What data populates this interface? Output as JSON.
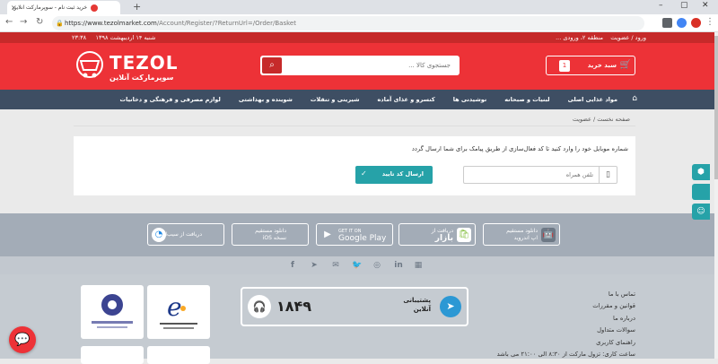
{
  "browser": {
    "tab_title": "خرید ثبت نام - سوپرمارکت آنلاین",
    "url_host": "https://www.tezolmarket.com",
    "url_path": "/Account/Register/?ReturnUrl=/Order/Basket",
    "new_tab_icon": "plus-icon"
  },
  "topstrip": {
    "date": "شنبه ۱۴ اردیبهشت ۱۳۹۸",
    "time": "۲۳:۳۸",
    "login": "ورود / عضویت",
    "region": "منطقه ۲، ورودی ..."
  },
  "header": {
    "brand": "TEZOL",
    "subtitle": "سوپرمارکت آنلاین",
    "search_placeholder": "جستجوی کالا ...",
    "cart_label": "سبد خرید",
    "cart_count": "1"
  },
  "nav": {
    "items": [
      "مواد غذایی اصلی",
      "لبنیات و صبحانه",
      "نوشیدنی ها",
      "کنسرو و غذای آماده",
      "شیرینی و تنقلات",
      "شوینده و بهداشتی",
      "لوازم مصرفی و فرهنگی و دخانیات"
    ]
  },
  "breadcrumb": {
    "home": "صفحه نخست",
    "current": "عضویت"
  },
  "register": {
    "message": "شماره موبایل خود را وارد کنید تا کد فعال‌سازی از طریق پیامک برای شما ارسال گردد",
    "phone_placeholder": "تلفن همراه",
    "send_label": "ارسال کد تایید"
  },
  "apps": {
    "android_1": "دانلود مستقیم",
    "android_2": "اپ اندروید",
    "bazaar_1": "دریافت از",
    "bazaar_2": "بازار",
    "gplay_1": "GET IT ON",
    "gplay_2": "Google Play",
    "ios_1": "دانلود مستقیم",
    "ios_2": "نسخه iOS",
    "sibapp": "دریافت از سیب‌اپ"
  },
  "footer": {
    "support_label_1": "پشتیبانی",
    "support_label_2": "آنلاین",
    "support_number": "۱۸۴۹",
    "links": [
      "تماس با ما",
      "قوانین و مقررات",
      "درباره ما",
      "سوالات متداول",
      "راهنمای کاربری",
      "ساعت کاری: تزول مارکت از ۸:۳۰ الی ۲۱:۰۰ می باشد"
    ]
  },
  "colors": {
    "brand_red": "#ed3237",
    "nav_bg": "#3e4e63",
    "accent_teal": "#26a2a8"
  }
}
